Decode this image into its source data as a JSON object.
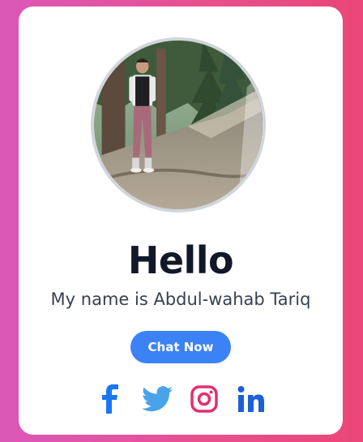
{
  "profile": {
    "greeting": "Hello",
    "intro": "My name is Abdul-wahab Tariq",
    "chat_button_label": "Chat Now",
    "avatar_border_color": "#d1d5db"
  },
  "socials": [
    {
      "name": "facebook",
      "icon": "facebook-icon",
      "color": "#1877f2"
    },
    {
      "name": "twitter",
      "icon": "twitter-icon",
      "color": "#4aa3e8"
    },
    {
      "name": "instagram",
      "icon": "instagram-icon",
      "color": "#e1306c"
    },
    {
      "name": "linkedin",
      "icon": "linkedin-icon",
      "color": "#1d5fd6"
    }
  ],
  "colors": {
    "background_gradient": [
      "#db58b9",
      "#ea4677"
    ],
    "accent": "#3b82f6",
    "heading": "#111827",
    "text": "#374151"
  }
}
